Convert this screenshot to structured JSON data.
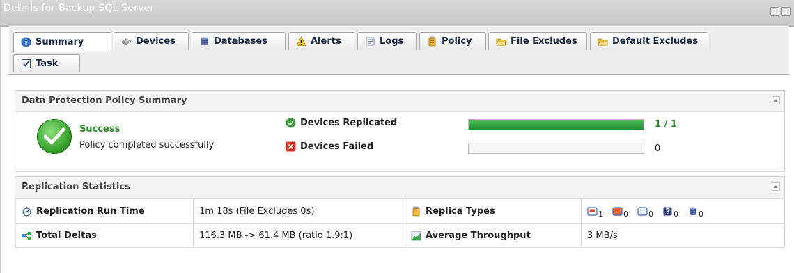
{
  "window": {
    "title": "Details for Backup SQL Server"
  },
  "tabs": [
    {
      "label": "Summary",
      "icon": "info-icon",
      "active": true
    },
    {
      "label": "Devices",
      "icon": "device-icon"
    },
    {
      "label": "Databases",
      "icon": "database-icon"
    },
    {
      "label": "Alerts",
      "icon": "warning-icon"
    },
    {
      "label": "Logs",
      "icon": "log-icon"
    },
    {
      "label": "Policy",
      "icon": "policy-icon"
    },
    {
      "label": "File Excludes",
      "icon": "folder-icon"
    },
    {
      "label": "Default Excludes",
      "icon": "folder-icon"
    },
    {
      "label": "Task",
      "icon": "task-icon"
    }
  ],
  "policy_summary": {
    "header": "Data Protection Policy Summary",
    "status_title": "Success",
    "status_desc": "Policy completed successfully",
    "replicated": {
      "label": "Devices Replicated",
      "value_text": "1 / 1",
      "progress": 1.0
    },
    "failed": {
      "label": "Devices Failed",
      "value_text": "0",
      "progress": 0.0
    }
  },
  "replication_stats": {
    "header": "Replication Statistics",
    "run_time": {
      "label": "Replication Run Time",
      "value": "1m 18s (File Excludes 0s)"
    },
    "total_deltas": {
      "label": "Total Deltas",
      "value": "116.3 MB -> 61.4 MB (ratio 1.9:1)"
    },
    "replica_types": {
      "label": "Replica Types",
      "items": [
        {
          "icon": "replica-red-icon",
          "count": "1"
        },
        {
          "icon": "replica-orange-icon",
          "count": "0"
        },
        {
          "icon": "replica-blue-icon",
          "count": "0"
        },
        {
          "icon": "replica-question-icon",
          "count": "0"
        },
        {
          "icon": "replica-database-icon",
          "count": "0"
        }
      ]
    },
    "throughput": {
      "label": "Average Throughput",
      "value": "3 MB/s"
    }
  },
  "colors": {
    "success_green": "#2e8b2e",
    "progress_green": "#1f8f2f",
    "error_red": "#d62f1f",
    "tab_text": "#1a2a44"
  }
}
